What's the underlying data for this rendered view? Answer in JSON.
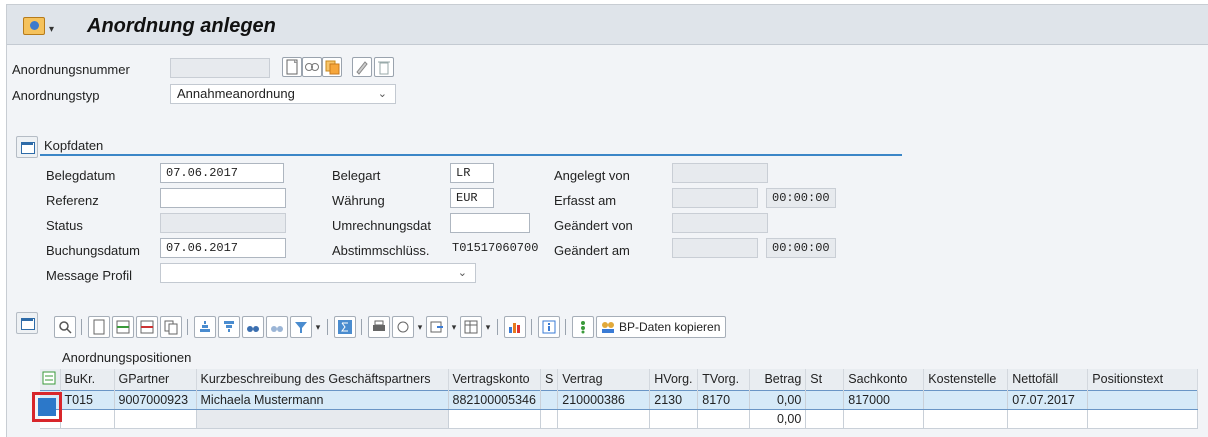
{
  "title": "Anordnung anlegen",
  "header": {
    "anordnungsnummer_label": "Anordnungsnummer",
    "anordnungsnummer_value": "",
    "anordnungstyp_label": "Anordnungstyp",
    "anordnungstyp_value": "Annahmeanordnung"
  },
  "kopf": {
    "section_title": "Kopfdaten",
    "belegdatum_label": "Belegdatum",
    "belegdatum_value": "07.06.2017",
    "referenz_label": "Referenz",
    "referenz_value": "",
    "status_label": "Status",
    "status_value": "",
    "buchungsdatum_label": "Buchungsdatum",
    "buchungsdatum_value": "07.06.2017",
    "message_label": "Message Profil",
    "message_value": "",
    "belegart_label": "Belegart",
    "belegart_value": "LR",
    "waehrung_label": "Währung",
    "waehrung_value": "EUR",
    "umrechnung_label": "Umrechnungsdat",
    "umrechnung_value": "",
    "abstimm_label": "Abstimmschlüss.",
    "abstimm_value": "T01517060700",
    "angelegt_von_label": "Angelegt von",
    "angelegt_von_value": "",
    "erfasst_am_label": "Erfasst am",
    "erfasst_am_value": "",
    "erfasst_zeit": "00:00:00",
    "geaendert_von_label": "Geändert von",
    "geaendert_von_value": "",
    "geaendert_am_label": "Geändert am",
    "geaendert_am_value": "",
    "geaendert_zeit": "00:00:00"
  },
  "toolbar": {
    "bp_button_label": "BP-Daten kopieren"
  },
  "positions": {
    "section_title": "Anordnungspositionen",
    "columns": [
      "BuKr.",
      "GPartner",
      "Kurzbeschreibung des Geschäftspartners",
      "Vertragskonto",
      "S",
      "Vertrag",
      "HVorg.",
      "TVorg.",
      "Betrag",
      "St",
      "Sachkonto",
      "Kostenstelle",
      "Nettofäll",
      "Positionstext"
    ],
    "rows": [
      [
        "T015",
        "9007000923",
        "Michaela Mustermann",
        "882100005346",
        "",
        "210000386",
        "2130",
        "8170",
        "0,00",
        "",
        "817000",
        "",
        "07.07.2017",
        ""
      ],
      [
        "",
        "",
        "",
        "",
        "",
        "",
        "",
        "",
        "0,00",
        "",
        "",
        "",
        "",
        ""
      ]
    ]
  },
  "colors": {
    "accent": "#3b86c7",
    "selection": "#d6eaf8",
    "highlight": "#d8262b"
  }
}
